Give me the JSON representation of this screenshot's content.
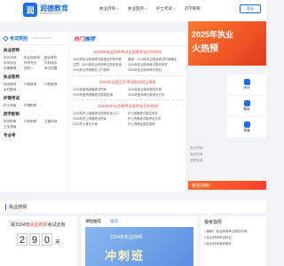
{
  "header": {
    "logo_char": "润",
    "logo_cn": "润德教育",
    "logo_en": "RUNDE EDUCATION",
    "nav": [
      {
        "label": "执业药师",
        "active": false
      },
      {
        "label": "执业医师",
        "active": false
      },
      {
        "label": "护士考试",
        "active": false
      },
      {
        "label": "药学职称",
        "active": false
      }
    ],
    "user_btn": "登录"
  },
  "categories": {
    "title": "考试类别",
    "subtitle": "CLASSIFICATION",
    "groups": [
      {
        "title": "执业药师",
        "links": [
          "执业药师",
          "执业西药师",
          "报名条件",
          "药学综合",
          "药学专业",
          "中药综合",
          "药事管理",
          "西药一",
          "考试试题"
        ]
      },
      {
        "title": "执业医师",
        "links": [
          "临床医师",
          "中医医师",
          "口腔医师",
          "乡村医师"
        ]
      },
      {
        "title": "护理考试",
        "links": [
          "护士资格",
          "护理职称"
        ]
      },
      {
        "title": "药学职称",
        "links": [
          "药学职称",
          "中药职称",
          "主管药师",
          "卫生资格"
        ]
      },
      {
        "title": "专业考",
        "links": []
      }
    ]
  },
  "hot": {
    "title_red": "热门",
    "title_blue": "推荐",
    "notices": [
      "2024年执业药师考试全国准考证打印时间",
      "2024年全国卫生考试报名网上报名",
      "2024年护士资格考试准考证打印时间"
    ],
    "rows_a": [
      [
        "2024年执业药师考试准考证打印时间",
        "重磅！2024年执业药师考试时间确定"
      ],
      [
        "注意！2024年执业药师考试成绩查询",
        "2024年执业药师考试报名条件"
      ],
      [
        "2024执业药师报名入口官网",
        "2024年执业药师考试科目"
      ]
    ],
    "rows_b": [
      [
        "2024年医师资格考试时间",
        "2024年执业医师报名时间"
      ],
      [
        "2024年医师资格考试成绩查询",
        "2024年医师考试准考证打印"
      ]
    ],
    "rows_c": [
      [
        "2024年护士资格考试成绩查询入口",
        "护士资格考试报名条件"
      ],
      [
        "2024年护士资格考试时间",
        "护士资格考试准考证打印"
      ],
      [
        "2024护士考试大纲",
        "护士资格证报名官网"
      ]
    ]
  },
  "banner": {
    "line1": "2025年执业",
    "line2": "火热预"
  },
  "side_icons": [
    {
      "label": "资讯"
    },
    {
      "label": "题库"
    },
    {
      "label": "直播"
    }
  ],
  "side_text": [
    "执业药师",
    "报名时间",
    "成绩查询"
  ],
  "promo_strip": "考前冲刺",
  "section": {
    "title": "执业药师"
  },
  "countdown": {
    "prefix": "距2024年",
    "highlight": "执业药师",
    "suffix": "考试还有",
    "digits": [
      "2",
      "9",
      "0"
    ],
    "unit": "天"
  },
  "course": {
    "title": "课程推荐",
    "tab": "资讯",
    "img_line1": "2024年执业药师",
    "img_line2": "冲刺班"
  },
  "news": {
    "title": "报考指导",
    "items": [
      "1.最新！执业药师考试报名时间",
      "2.执业药师考试科目",
      "3.执业药师报考条件"
    ]
  }
}
